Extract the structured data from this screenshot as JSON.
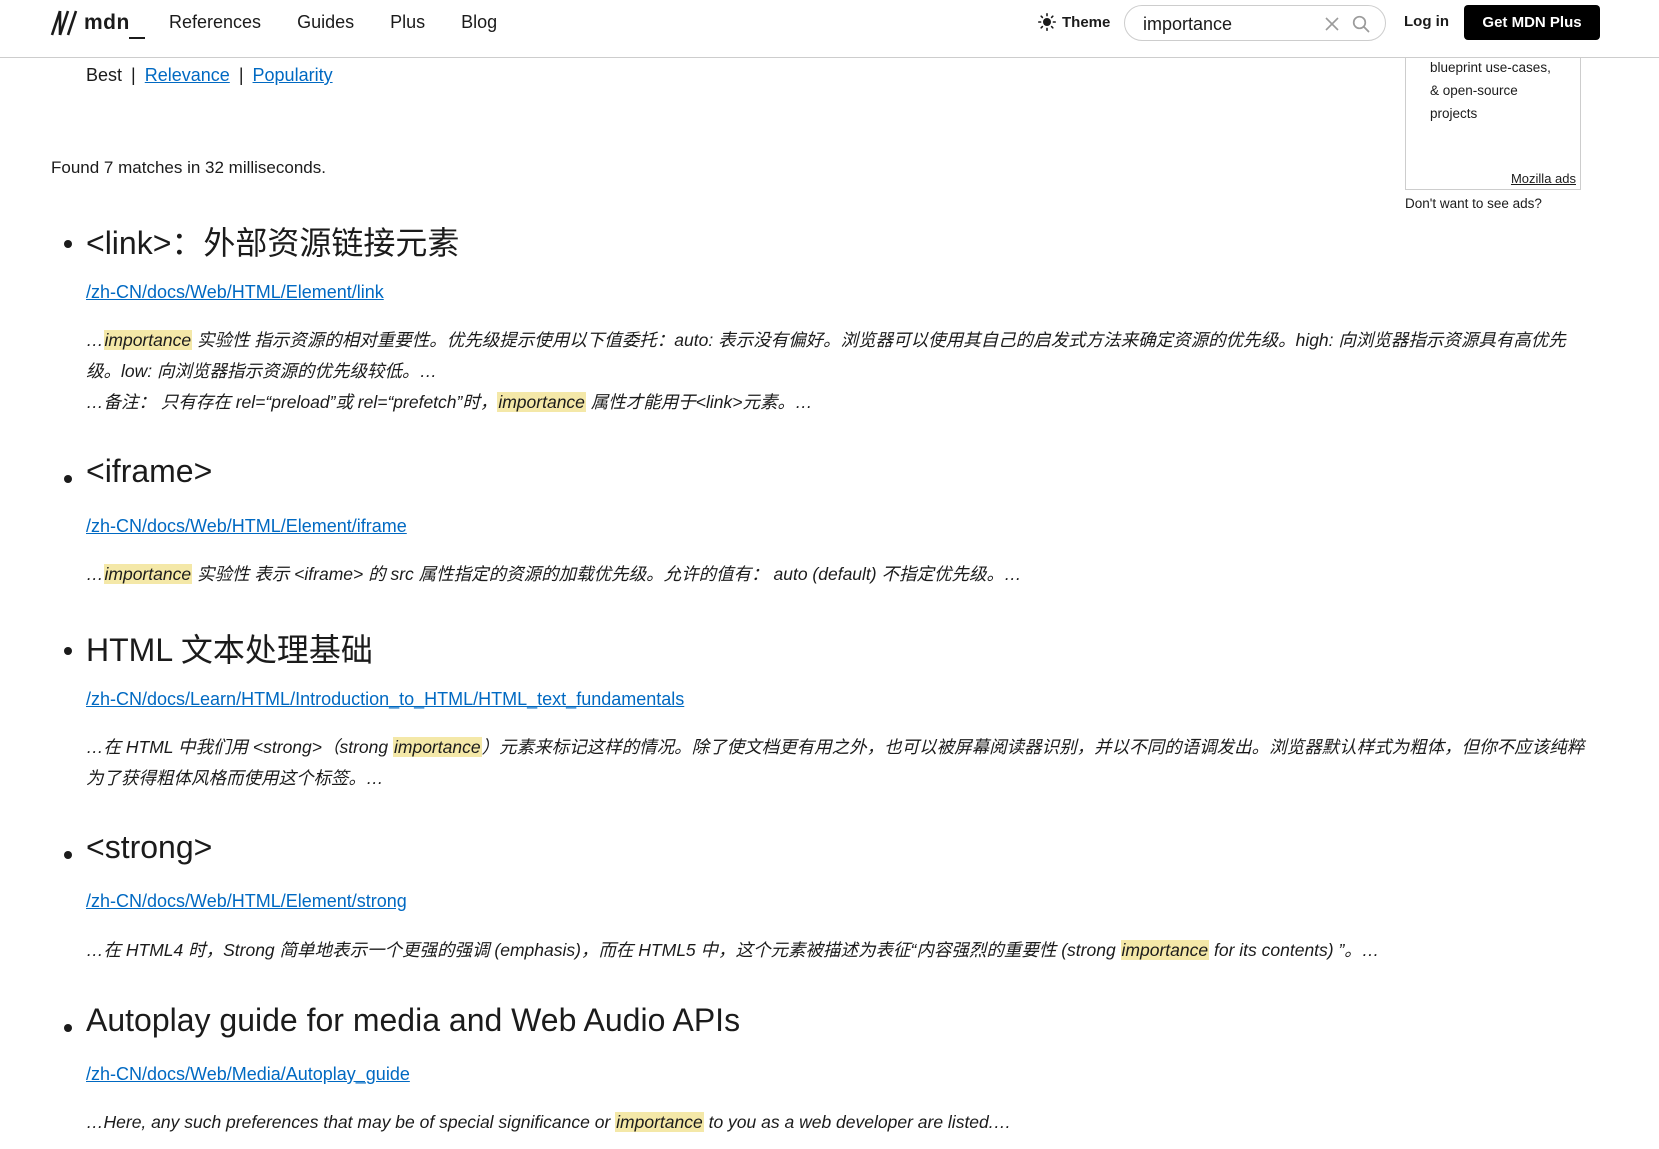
{
  "header": {
    "logo_text": "mdn",
    "nav": [
      "References",
      "Guides",
      "Plus",
      "Blog"
    ],
    "theme_label": "Theme",
    "search": {
      "value": "importance",
      "placeholder": ""
    },
    "login_label": "Log in",
    "plus_label": "Get MDN Plus"
  },
  "ad": {
    "lines": [
      "blueprint use-cases,",
      "& open-source",
      "projects"
    ],
    "link_label": "Mozilla ads",
    "no_ads_label": "Don't want to see ads?"
  },
  "sort": {
    "best": "Best",
    "sep": "|",
    "relevance": "Relevance",
    "popularity": "Popularity"
  },
  "found_text": "Found 7 matches in 32 milliseconds.",
  "colors": {
    "link": "#0069c2",
    "highlight": "#f4e8a8",
    "text": "#1b1b1b"
  },
  "results": [
    {
      "title": "<link>：外部资源链接元素",
      "url": "/zh-CN/docs/Web/HTML/Element/link",
      "snippets": [
        [
          "…",
          "importance",
          " 实验性 指示资源的相对重要性。优先级提示使用以下值委托：auto: 表示没有偏好。浏览器可以使用其自己的启发式方法来确定资源的优先级。high: 向浏览器指示资源具有高优先级。low: 向浏览器指示资源的优先级较低。…"
        ],
        [
          "…备注： 只有存在 rel=“preload”或 rel=“prefetch”时，",
          "importance",
          " 属性才能用于<link>元素。…"
        ]
      ]
    },
    {
      "title": "<iframe>",
      "url": "/zh-CN/docs/Web/HTML/Element/iframe",
      "snippets": [
        [
          "…",
          "importance",
          " 实验性 表示 <iframe> 的 src 属性指定的资源的加载优先级。允许的值有： auto (default) 不指定优先级。…"
        ]
      ]
    },
    {
      "title": "HTML 文本处理基础",
      "url": "/zh-CN/docs/Learn/HTML/Introduction_to_HTML/HTML_text_fundamentals",
      "snippets": [
        [
          "…在 HTML 中我们用 <strong>（strong ",
          "importance",
          "）元素来标记这样的情况。除了使文档更有用之外，也可以被屏幕阅读器识别，并以不同的语调发出。浏览器默认样式为粗体，但你不应该纯粹为了获得粗体风格而使用这个标签。…"
        ]
      ]
    },
    {
      "title": "<strong>",
      "url": "/zh-CN/docs/Web/HTML/Element/strong",
      "snippets": [
        [
          "…在 HTML4 时，Strong 简单地表示一个更强的强调 (emphasis)，而在 HTML5 中，这个元素被描述为表征“内容强烈的重要性 (strong ",
          "importance",
          " for its contents) ”。…"
        ]
      ]
    },
    {
      "title": "Autoplay guide for media and Web Audio APIs",
      "url": "/zh-CN/docs/Web/Media/Autoplay_guide",
      "snippets": [
        [
          "…Here, any such preferences that may be of special significance or ",
          "importance",
          " to you as a web developer are listed.…"
        ]
      ]
    }
  ]
}
